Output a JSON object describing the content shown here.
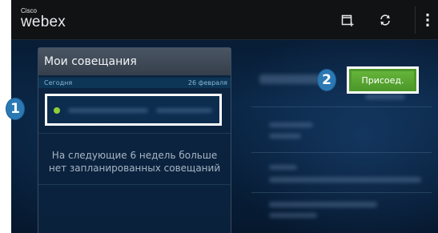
{
  "app": {
    "logo_small": "Cisco",
    "logo_big": "webex"
  },
  "toolbar": {
    "icons": [
      "calendar-add-icon",
      "refresh-icon",
      "overflow-menu-icon"
    ]
  },
  "meetings_panel": {
    "title": "Мои совещания",
    "today_label": "Сегодня",
    "date_label": "26 февраля",
    "meeting_status_color": "#8dd03c",
    "empty_message": "На следующие 6 недель больше нет запланированных совещаний"
  },
  "actions": {
    "join_label": "Присоед."
  },
  "callouts": {
    "one": "1",
    "two": "2"
  },
  "colors": {
    "action_bar": "#101214",
    "accent_green": "#5aa832",
    "callout_blue": "#2b79b4",
    "background": "#0a2645"
  }
}
